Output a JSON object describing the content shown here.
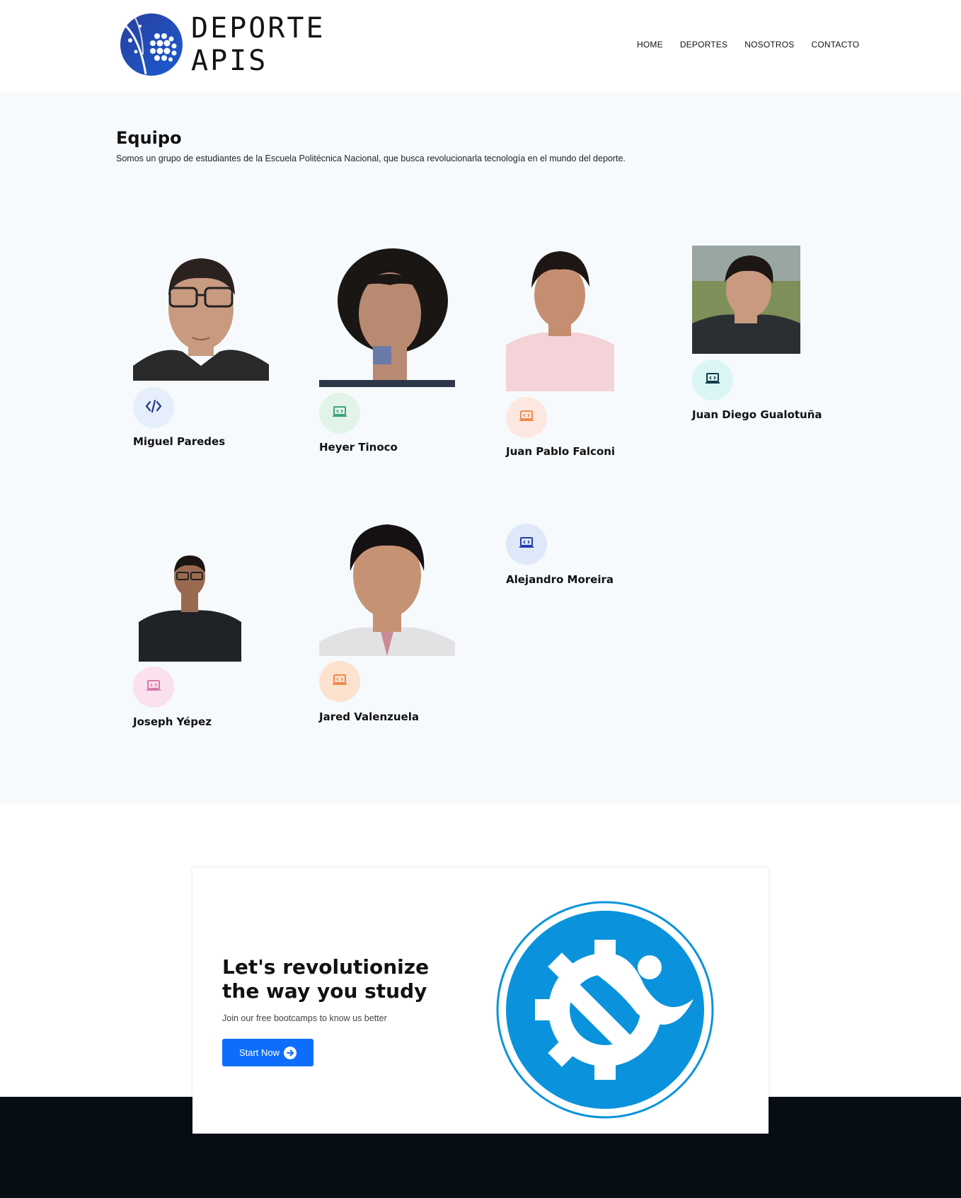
{
  "header": {
    "logo_text": "DEPORTE APIS",
    "nav": [
      "HOME",
      "DEPORTES",
      "NOSOTROS",
      "CONTACTO"
    ]
  },
  "team": {
    "title": "Equipo",
    "subtitle": "Somos un grupo de estudiantes de la Escuela Politécnica Nacional, que busca revolucionarla tecnología en el mundo del deporte.",
    "members": [
      {
        "name": "Miguel Paredes",
        "icon": "code-icon",
        "icon_color": "#1e3a8a",
        "icon_bg": "#e7eefb"
      },
      {
        "name": "Heyer Tinoco",
        "icon": "laptop-code-icon",
        "icon_color": "#3aa676",
        "icon_bg": "#e2f4ea"
      },
      {
        "name": "Juan Pablo Falconi",
        "icon": "laptop-code-icon",
        "icon_color": "#f08a4b",
        "icon_bg": "#fde8e1"
      },
      {
        "name": "Juan Diego Gualotuña",
        "icon": "laptop-code-icon",
        "icon_color": "#0f3b48",
        "icon_bg": "#d9f6f4"
      },
      {
        "name": "Joseph Yépez",
        "icon": "laptop-code-icon",
        "icon_color": "#d87bb0",
        "icon_bg": "#fbe0ee"
      },
      {
        "name": "Jared Valenzuela",
        "icon": "laptop-code-icon",
        "icon_color": "#f08a4b",
        "icon_bg": "#fde2cf"
      },
      {
        "name": "Alejandro Moreira",
        "icon": "laptop-code-icon",
        "icon_color": "#1e40af",
        "icon_bg": "#dfe8f8"
      }
    ]
  },
  "cta": {
    "title": "Let's revolutionize the way you study",
    "subtitle": "Join our free bootcamps to know us better",
    "button_label": "Start Now",
    "brand_color": "#0a93dc"
  }
}
